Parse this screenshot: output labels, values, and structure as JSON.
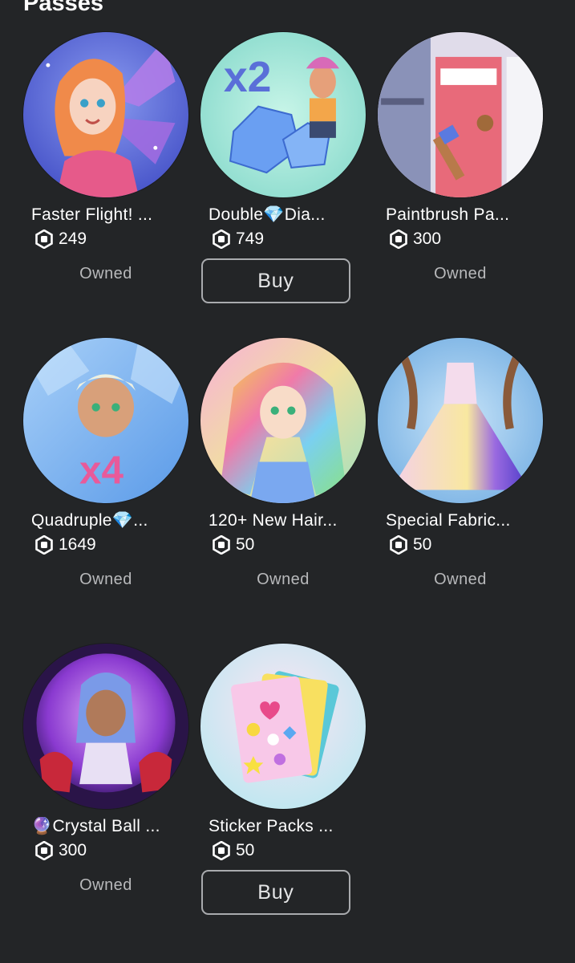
{
  "section": {
    "title": "Passes"
  },
  "passes": [
    {
      "name": "Faster Flight! ...",
      "price": "249",
      "status": "Owned",
      "thumb": "fairy-wings"
    },
    {
      "name": "Double💎Dia...",
      "price": "749",
      "buy_label": "Buy",
      "thumb": "diamonds-x2"
    },
    {
      "name": "Paintbrush Pa...",
      "price": "300",
      "status": "Owned",
      "thumb": "paintbrush-locker"
    },
    {
      "name": "Quadruple💎...",
      "price": "1649",
      "status": "Owned",
      "thumb": "diamonds-x4"
    },
    {
      "name": "120+ New Hair...",
      "price": "50",
      "status": "Owned",
      "thumb": "rainbow-hair"
    },
    {
      "name": "Special Fabric...",
      "price": "50",
      "status": "Owned",
      "thumb": "galaxy-dress"
    },
    {
      "name": "🔮Crystal Ball ...",
      "price": "300",
      "status": "Owned",
      "thumb": "crystal-ball"
    },
    {
      "name": "Sticker Packs ...",
      "price": "50",
      "buy_label": "Buy",
      "thumb": "sticker-sheets"
    }
  ],
  "icons": {
    "currency": "robux-icon"
  },
  "colors": {
    "background": "#232527",
    "status_text": "#b8b9bb",
    "button_border": "#a9abae"
  }
}
